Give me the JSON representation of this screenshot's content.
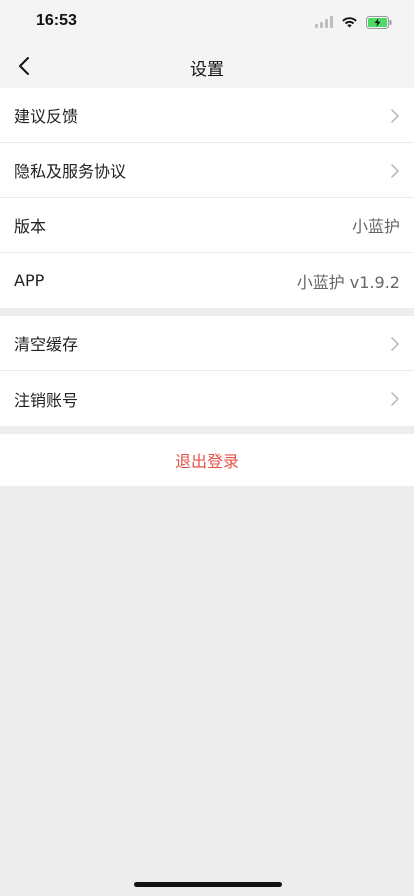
{
  "status_bar": {
    "time": "16:53"
  },
  "nav": {
    "title": "设置"
  },
  "group1": [
    {
      "label": "建议反馈",
      "type": "link"
    },
    {
      "label": "隐私及服务协议",
      "type": "link"
    },
    {
      "label": "版本",
      "value": "小蓝护"
    },
    {
      "label": "APP",
      "value": "小蓝护 v1.9.2"
    }
  ],
  "group2": [
    {
      "label": "清空缓存",
      "type": "link"
    },
    {
      "label": "注销账号",
      "type": "link"
    }
  ],
  "logout": {
    "label": "退出登录"
  },
  "colors": {
    "accent_red": "#e5534b",
    "background": "#ededed",
    "battery_green": "#4cd964"
  },
  "icons": [
    "back-chevron-icon",
    "signal-icon",
    "wifi-icon",
    "battery-charging-icon",
    "chevron-right-icon"
  ]
}
